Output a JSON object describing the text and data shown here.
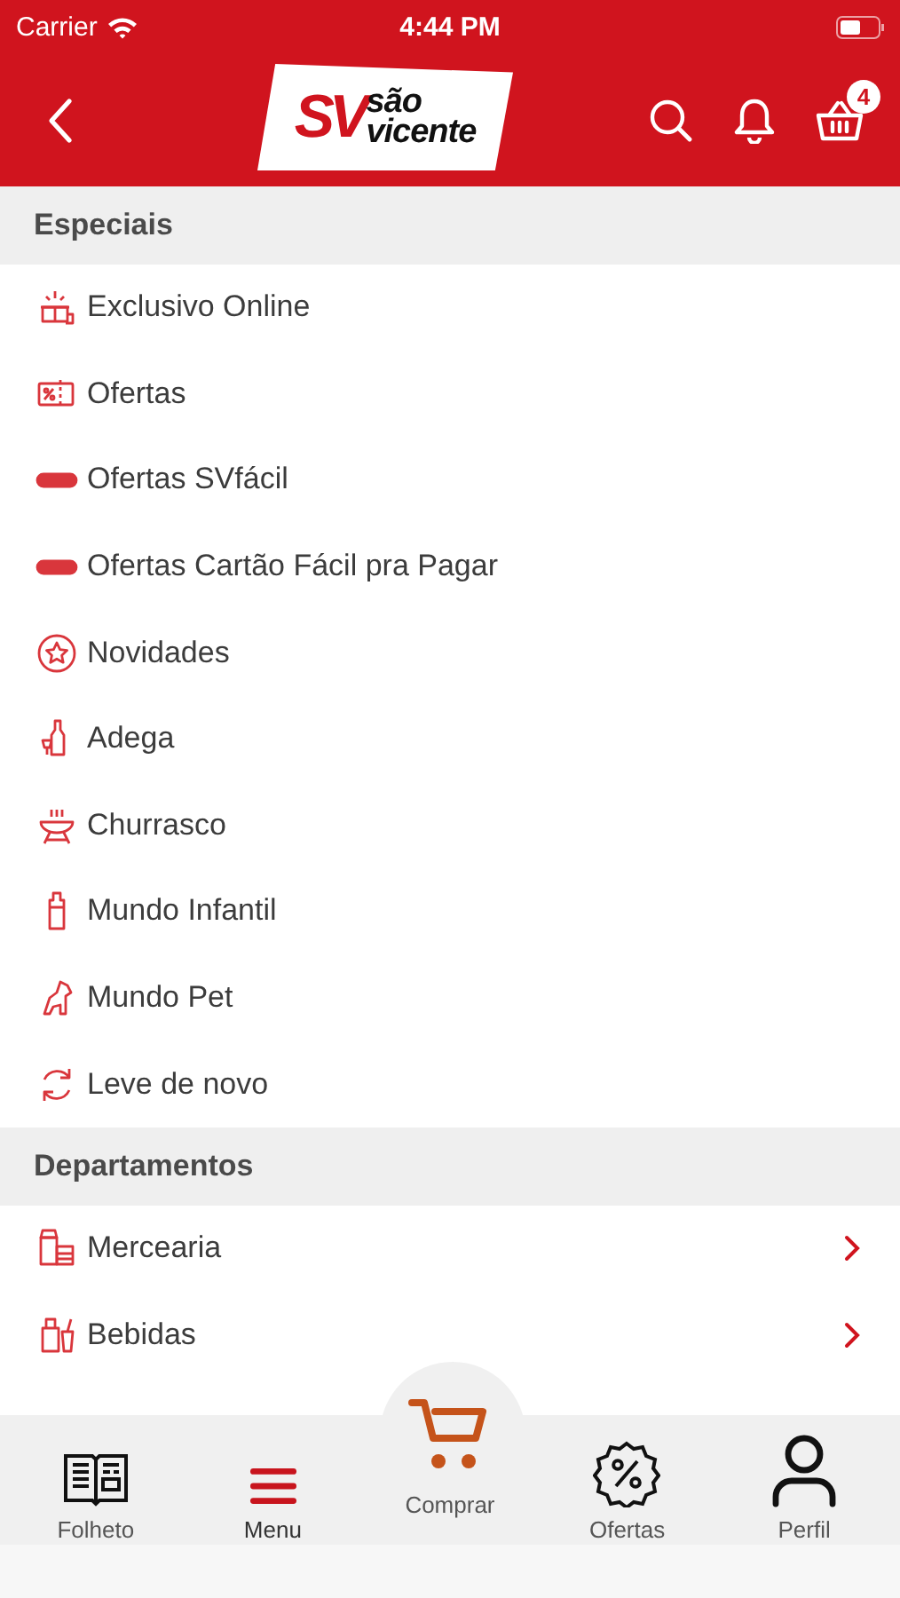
{
  "status_bar": {
    "carrier": "Carrier",
    "time": "4:44 PM"
  },
  "header": {
    "logo": {
      "mark": "SV",
      "name_top": "são",
      "name_bottom": "vicente"
    },
    "cart_count": "4"
  },
  "sections": [
    {
      "title": "Especiais",
      "kind": "featured",
      "items": [
        {
          "label": "Exclusivo Online"
        },
        {
          "label": "Ofertas"
        },
        {
          "label": "Ofertas SVfácil"
        },
        {
          "label": "Ofertas Cartão Fácil pra Pagar"
        },
        {
          "label": "Novidades"
        },
        {
          "label": "Adega"
        },
        {
          "label": "Churrasco"
        },
        {
          "label": "Mundo Infantil"
        },
        {
          "label": "Mundo Pet"
        },
        {
          "label": "Leve de novo"
        }
      ]
    },
    {
      "title": "Departamentos",
      "kind": "departments",
      "items": [
        {
          "label": "Mercearia"
        },
        {
          "label": "Bebidas"
        }
      ]
    }
  ],
  "tab_bar": [
    {
      "label": "Folheto",
      "kind": "leaflet",
      "selected": false
    },
    {
      "label": "Menu",
      "kind": "menu",
      "selected": true
    },
    {
      "label": "Comprar",
      "kind": "cart",
      "selected": false
    },
    {
      "label": "Ofertas",
      "kind": "offers",
      "selected": false
    },
    {
      "label": "Perfil",
      "kind": "profile",
      "selected": false
    }
  ]
}
